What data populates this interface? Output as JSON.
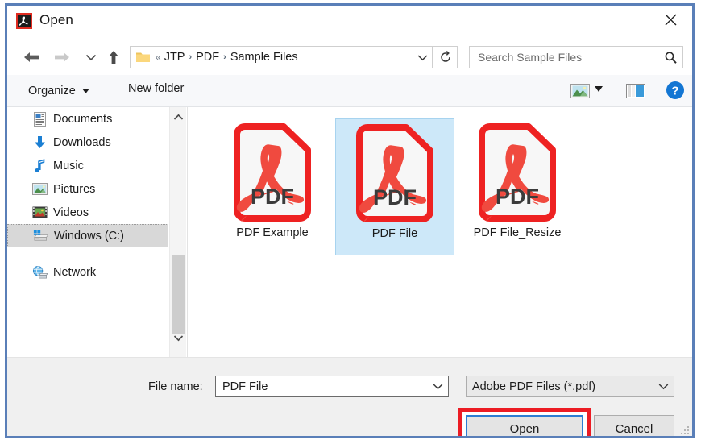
{
  "window": {
    "title": "Open",
    "app_icon": "adobe-acrobat-icon",
    "close_label": "✕",
    "border_color": "#5a7fb8"
  },
  "nav": {
    "back_glyph": "←",
    "forward_glyph": "→",
    "recent_glyph": "⌄",
    "up_glyph": "↑",
    "breadcrumb_overflow": "«",
    "breadcrumb": [
      "JTP",
      "PDF",
      "Sample Files"
    ],
    "breadcrumb_separator": "›",
    "address_caret": "⌄",
    "refresh_glyph": "↻"
  },
  "search": {
    "placeholder": "Search Sample Files",
    "value": "",
    "icon": "search-icon"
  },
  "commandbar": {
    "organize_label": "Organize",
    "organize_caret": "▼",
    "new_folder_label": "New folder",
    "view_icon": "picture-view-icon",
    "view_caret": "▼",
    "preview_pane_icon": "preview-pane-icon",
    "help_icon": "help-icon",
    "help_glyph": "?"
  },
  "sidebar": {
    "items": [
      {
        "label": "Documents",
        "icon": "documents-icon",
        "selected": false
      },
      {
        "label": "Downloads",
        "icon": "downloads-icon",
        "selected": false
      },
      {
        "label": "Music",
        "icon": "music-icon",
        "selected": false
      },
      {
        "label": "Pictures",
        "icon": "pictures-icon",
        "selected": false
      },
      {
        "label": "Videos",
        "icon": "videos-icon",
        "selected": false
      },
      {
        "label": "Windows (C:)",
        "icon": "drive-icon",
        "selected": true
      },
      {
        "label": "Network",
        "icon": "network-icon",
        "selected": false
      }
    ],
    "scrollbar": {
      "up_glyph": "⌃",
      "down_glyph": "⌄"
    }
  },
  "files": {
    "items": [
      {
        "name": "PDF Example",
        "icon": "pdf-file-icon",
        "badge": "PDF",
        "selected": false
      },
      {
        "name": "PDF File",
        "icon": "pdf-file-icon",
        "badge": "PDF",
        "selected": true
      },
      {
        "name": "PDF File_Resize",
        "icon": "pdf-file-icon",
        "badge": "PDF",
        "selected": false
      }
    ]
  },
  "bottom": {
    "filename_label": "File name:",
    "filename_value": "PDF File",
    "filename_caret": "⌄",
    "filetype_value": "Adobe PDF Files (*.pdf)",
    "filetype_caret": "⌄",
    "open_label": "Open",
    "cancel_label": "Cancel",
    "highlight_color": "#ec1c24",
    "focus_color": "#2d7dd2"
  }
}
